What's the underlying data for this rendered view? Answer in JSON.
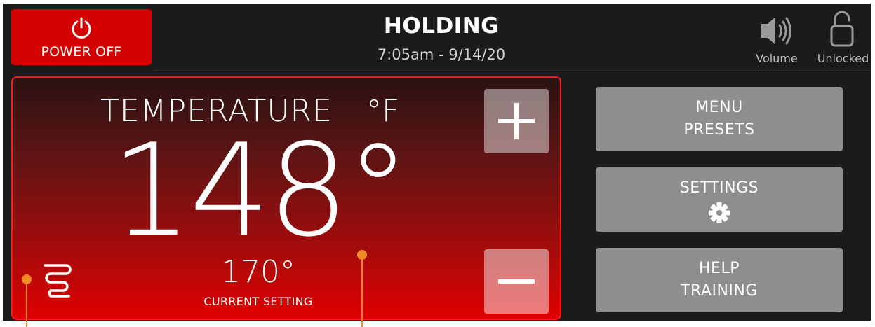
{
  "header": {
    "power_button_label": "POWER OFF",
    "status_title": "HOLDING",
    "status_time": "7:05am - 9/14/20",
    "volume_label": "Volume",
    "lock_label": "Unlocked",
    "icons": [
      "power-icon",
      "volume-icon",
      "unlocked-icon"
    ]
  },
  "temperature": {
    "title": "TEMPERATURE",
    "unit": "°F",
    "current_value": "148°",
    "setting_value": "170°",
    "setting_label": "CURRENT SETTING",
    "increase_icon": "plus-icon",
    "decrease_icon": "minus-icon",
    "heater_icon": "heating-element-icon"
  },
  "menu": {
    "presets": {
      "line1": "MENU",
      "line2": "PRESETS"
    },
    "settings": {
      "line1": "SETTINGS",
      "icon": "gear-icon"
    },
    "help": {
      "line1": "HELP",
      "line2": "TRAINING"
    }
  },
  "colors": {
    "accent_red": "#d40000",
    "panel_border": "#ff1a1a",
    "callout_orange": "#f08a24",
    "button_gray": "#8e8e8e",
    "background": "#1b1b1b"
  }
}
